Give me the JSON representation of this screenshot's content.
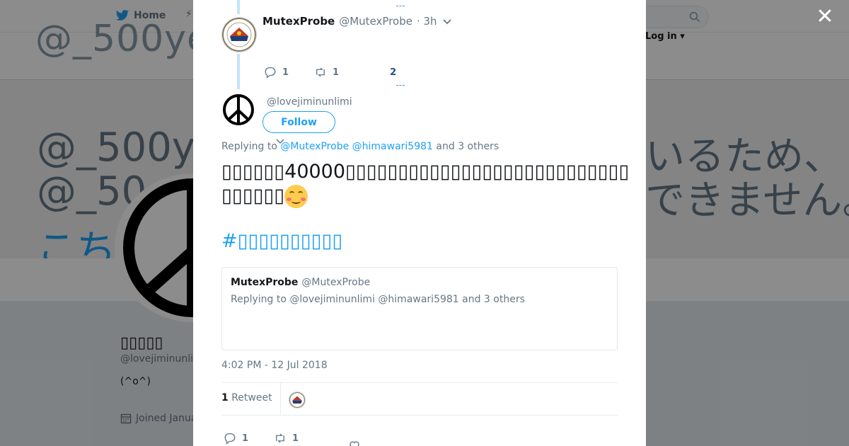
{
  "colors": {
    "accent": "#1da1f2",
    "overlay": "rgba(0,0,0,0.45)",
    "thread_line": "#c4e4f7"
  },
  "background": {
    "nav": {
      "home_label": "Home",
      "login_label": "Log in ▾"
    },
    "banner": {
      "top_text": "@_500ye",
      "line1_left": "@_500ye",
      "line2_left": "@_50",
      "line3_left": "こち",
      "line1_right": "いるため、",
      "line2_right": "できません。"
    },
    "profile": {
      "name": "▯▯▯▯▯",
      "handle": "@lovejiminunli",
      "bio": "(^o^)",
      "joined": "Joined Janua"
    }
  },
  "modal": {
    "close_icon": "close-icon",
    "parent_tweet": {
      "name": "MutexProbe",
      "handle": "@MutexProbe",
      "time": "· 3h",
      "reply_count": "1",
      "retweet_count": "1",
      "like_count": "2"
    },
    "main_tweet": {
      "handle": "@lovejiminunlimi",
      "follow_label": "Follow",
      "replying_prefix": "Replying to",
      "replying_mention1": "@MutexProbe",
      "replying_mention2": "@himawari5981",
      "replying_suffix": "and 3 others",
      "text": "▯▯▯▯▯▯40000▯▯▯▯▯▯▯▯▯▯▯▯▯▯▯▯▯▯▯▯▯▯▯▯▯▯▯▯▯▯▯▯▯",
      "hashtag": "#▯▯▯▯▯▯▯▯▯▯",
      "quote": {
        "name": "MutexProbe",
        "handle": "@MutexProbe",
        "replying": "Replying to @lovejiminunlimi @himawari5981 and 3 others"
      },
      "timestamp": "4:02 PM - 12 Jul 2018",
      "retweet_count": "1",
      "retweet_label": "Retweet",
      "reply_count": "1",
      "retweet_action_count": "1"
    }
  }
}
